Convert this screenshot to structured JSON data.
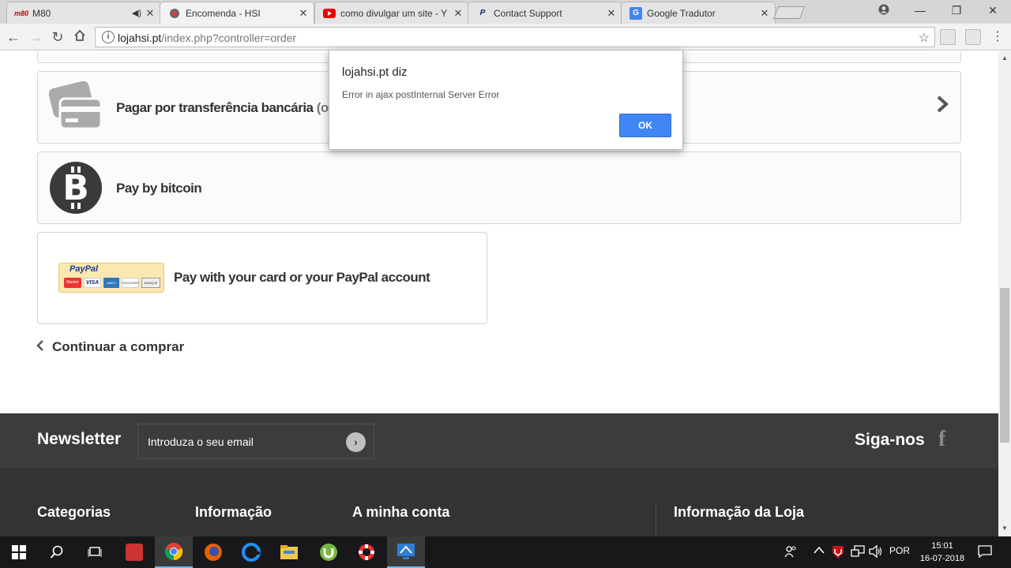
{
  "browser": {
    "tabs": [
      {
        "title": "M80",
        "favicon": "m80-icon",
        "fav_text": "m80",
        "audio": true
      },
      {
        "title": "Encomenda - HSI",
        "favicon": "hsi-icon",
        "active": true
      },
      {
        "title": "como divulgar um site - Y",
        "favicon": "youtube-icon"
      },
      {
        "title": "Contact Support",
        "favicon": "paypal-icon",
        "fav_text": "P"
      },
      {
        "title": "Google Tradutor",
        "favicon": "google-translate-icon",
        "fav_text": "G"
      }
    ],
    "close_glyph": "✕",
    "url_host": "lojahsi.pt",
    "url_path": "/index.php?controller=order"
  },
  "payment": {
    "bank_transfer_label": "Pagar por transferência bancária",
    "bank_transfer_note": "(o pr",
    "bitcoin_label": "Pay by bitcoin",
    "bitcoin_symbol": "B",
    "paypal_label": "Pay with your card or your PayPal account",
    "paypal_logo_text": "PayPal",
    "paypal_cards": [
      "Master",
      "VISA",
      "AMEX",
      "DISCOVER",
      "BANQUE"
    ]
  },
  "continue_shopping": "Continuar a comprar",
  "newsletter": {
    "title": "Newsletter",
    "placeholder": "Introduza o seu email",
    "follow_us": "Siga-nos",
    "facebook_glyph": "f"
  },
  "footer": {
    "columns": [
      "Categorias",
      "Informação",
      "A minha conta",
      "Informação da Loja"
    ]
  },
  "dialog": {
    "title": "lojahsi.pt diz",
    "message": "Error in ajax postInternal Server Error",
    "ok_label": "OK"
  },
  "taskbar": {
    "language": "POR",
    "time": "15:01",
    "date": "16-07-2018"
  },
  "colors": {
    "dialog_button": "#4285f4",
    "footer_bg": "#333333",
    "newsletter_bg": "#3c3c3c"
  }
}
